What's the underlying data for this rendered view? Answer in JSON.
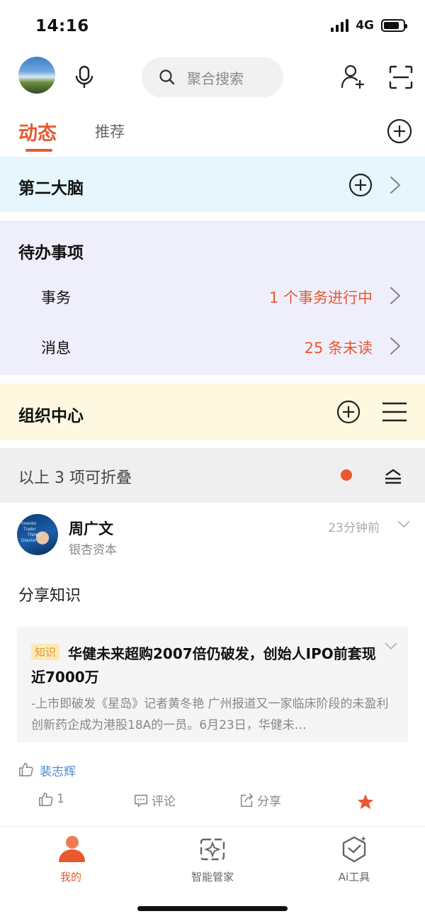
{
  "status": {
    "time": "14:16",
    "network": "4G"
  },
  "header": {
    "search_placeholder": "聚合搜索"
  },
  "tabs": [
    {
      "label": "动态",
      "active": true
    },
    {
      "label": "推荐",
      "active": false
    }
  ],
  "sections": {
    "brain": {
      "title": "第二大脑"
    },
    "todo": {
      "title": "待办事项",
      "rows": [
        {
          "label": "事务",
          "value": "1 个事务进行中"
        },
        {
          "label": "消息",
          "value": "25 条未读"
        }
      ]
    },
    "org": {
      "title": "组织中心"
    },
    "fold": {
      "text": "以上 3 项可折叠"
    }
  },
  "post": {
    "author": "周广文",
    "org": "银杏资本",
    "time": "23分钟前",
    "avatar_text": [
      "Investor",
      "Trader",
      "Thinker",
      "Director"
    ],
    "body": "分享知识",
    "card": {
      "tag": "知识",
      "title": "华健未来超购2007倍仍破发，创始人IPO前套现近7000万",
      "desc": "-上市即破发《星岛》记者黄冬艳 广州报道又一家临床阶段的未盈利创新药企成为港股18A的一员。6月23日，华健未…"
    },
    "liker": "裴志辉",
    "actions": {
      "like_count": "1",
      "comment": "评论",
      "share": "分享"
    }
  },
  "nav": [
    {
      "label": "我的",
      "active": true,
      "icon": "person-icon"
    },
    {
      "label": "智能管家",
      "active": false,
      "icon": "sparkle-icon"
    },
    {
      "label": "Ai工具",
      "active": false,
      "icon": "cube-icon"
    }
  ],
  "colors": {
    "accent": "#e9592f",
    "link": "#4f8fd2",
    "brain_bg": "#e6f6fc",
    "todo_bg": "#efeffb",
    "org_bg": "#fdf8df"
  }
}
